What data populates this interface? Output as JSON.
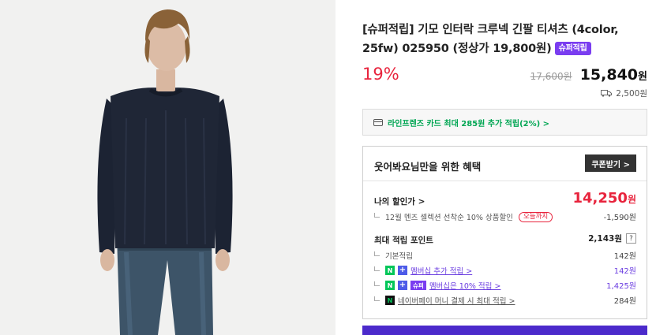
{
  "product": {
    "title": "[슈퍼적립] 기모 인터락 크루넥 긴팔 티셔츠 (4color, 25fw) 025950 (정상가 19,800원)",
    "badge": "슈퍼적립",
    "discount_rate": "19%",
    "original_price": "17,600원",
    "sale_price_number": "15,840",
    "sale_price_unit": "원",
    "shipping_fee": "2,500원",
    "shipping_icon": "truck-icon"
  },
  "card_banner": {
    "icon": "card-icon",
    "text": "라인프렌즈 카드 최대 285원 추가 적립(2%) >"
  },
  "benefit": {
    "title": "웃어봐요님만을 위한 혜택",
    "coupon_button": "쿠폰받기 >",
    "my_price_label": "나의 할인가 >",
    "my_price_number": "14,250",
    "my_price_unit": "원",
    "coupon_line": "12월 멘즈 셀렉션 선착순 10% 상품할인",
    "today_tag": "오늘까지",
    "coupon_amount": "-1,590원",
    "points_label": "최대 적립 포인트",
    "points_total": "2,143원",
    "points_help": "?",
    "points": [
      {
        "label": "기본적립",
        "value": "142원"
      },
      {
        "label": "멤버십 추가 적립 >",
        "value": "142원"
      },
      {
        "label": "멤버십은 10% 적립 >",
        "value": "1,425원"
      },
      {
        "label": "네이버페이 머니 결제 시 최대 적립 >",
        "value": "284원"
      }
    ],
    "badges": {
      "n": "N",
      "plus": "+",
      "super": "슈퍼",
      "npay": "N"
    }
  },
  "colors": {
    "discount_red": "#e8243d",
    "super_purple": "#7a3df0",
    "card_green": "#00a653",
    "naver_green": "#03c75a",
    "buy_bar": "#4b2acb"
  }
}
